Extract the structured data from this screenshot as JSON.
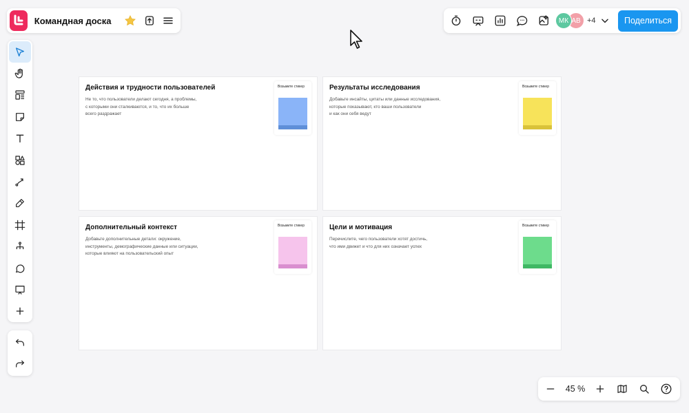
{
  "board": {
    "title": "Командная доска",
    "logo_color": "#ee2a5d",
    "icons": [
      "app-logo-icon",
      "star-icon",
      "export-icon",
      "menu-icon"
    ]
  },
  "top_right": {
    "icons": [
      "timer-icon",
      "presentation-icon",
      "analytics-icon",
      "comments-icon",
      "ai-image-icon"
    ],
    "avatars": [
      {
        "initials": "МК",
        "color": "#5dc8a0"
      },
      {
        "initials": "АВ",
        "color": "#f2a0a8"
      }
    ],
    "more_count": "+4",
    "share_label": "Поделиться",
    "accent": "#1a96f0"
  },
  "toolbar": {
    "tools": [
      "select",
      "hand",
      "templates",
      "sticky-note",
      "text",
      "shapes",
      "connector",
      "pen",
      "frame",
      "mindmap",
      "comment",
      "presentation",
      "add"
    ],
    "active": "select",
    "history": [
      "undo",
      "redo"
    ]
  },
  "zoom": {
    "level": "45 %",
    "icons": [
      "zoom-out-icon",
      "zoom-in-icon",
      "minimap-icon",
      "search-icon",
      "help-icon"
    ]
  },
  "cards": [
    {
      "title": "Действия и трудности пользователей",
      "description": "Не то, что пользователи делают сегодня, а проблемы,\nс которыми они сталкиваются, и то, что их больше\nвсего раздражает",
      "sticker_label": "Возьмите стикер",
      "note_color": "#8ab4f8",
      "note_shade": "#5f8fd8"
    },
    {
      "title": "Результаты исследования",
      "description": "Добавьте инсайты, цитаты или данные исследования,\nкоторые показывают, кто ваши пользователи\nи как они себя ведут",
      "sticker_label": "Возьмите стикер",
      "note_color": "#f7e35a",
      "note_shade": "#d9c23a"
    },
    {
      "title": "Дополнительный контекст",
      "description": "Добавьте дополнительные детали: окружение,\nинструменты, демографические данные или ситуации,\nкоторые влияют на пользовательский опыт",
      "sticker_label": "Возьмите стикер",
      "note_color": "#f6c4ec",
      "note_shade": "#d98fcf"
    },
    {
      "title": "Цели и мотивация",
      "description": "Перечислите, чего пользователи хотят достичь,\nчто ими движет и что для них означает успех",
      "sticker_label": "Возьмите стикер",
      "note_color": "#6ddc8c",
      "note_shade": "#3fb864"
    }
  ]
}
